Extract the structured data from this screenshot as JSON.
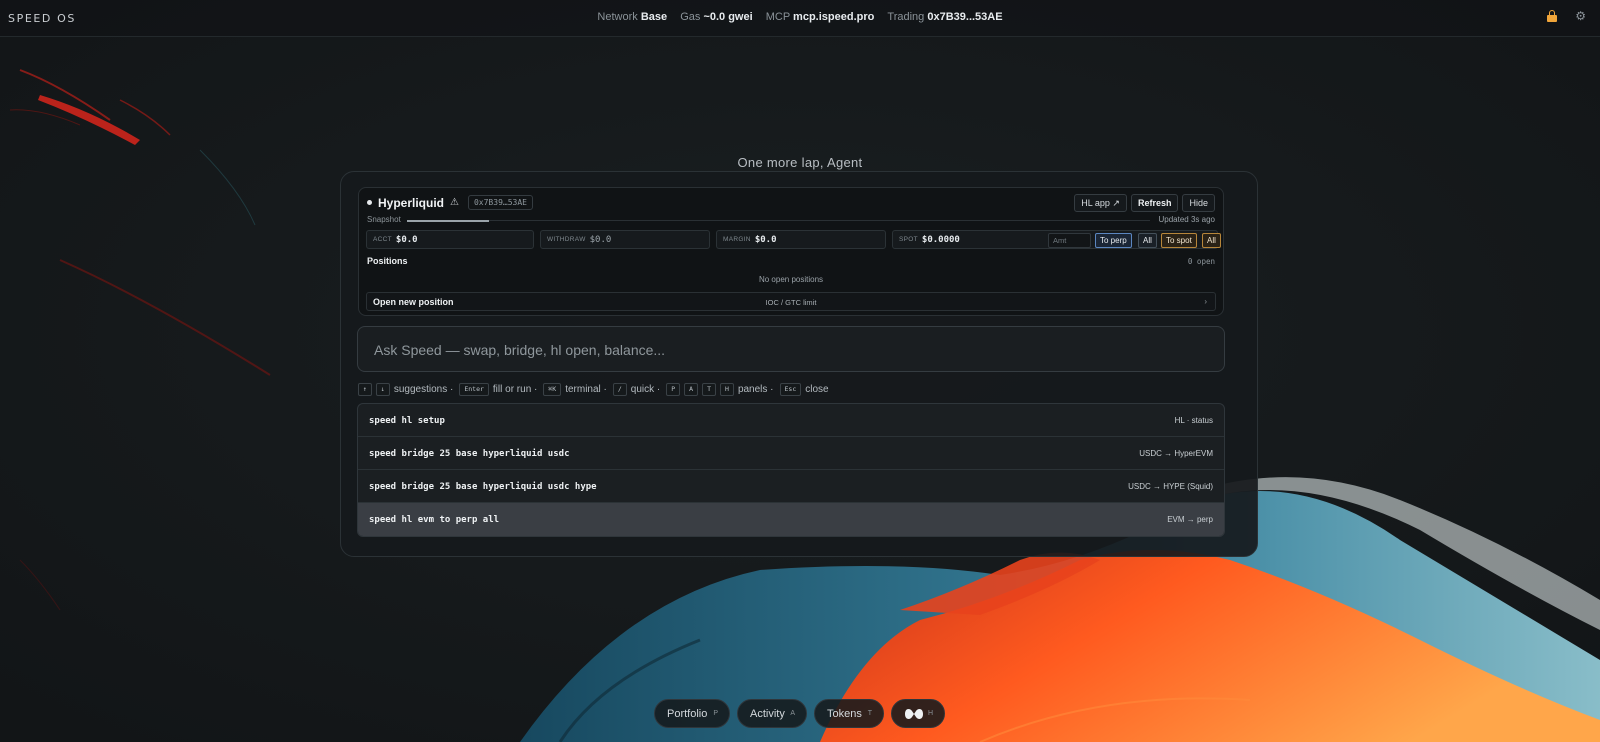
{
  "app": {
    "brand": "SPEED OS"
  },
  "status": {
    "network_label": "Network",
    "network_value": "Base",
    "gas_label": "Gas",
    "gas_value": "~0.0 gwei",
    "mcp_label": "MCP",
    "mcp_value": "mcp.ispeed.pro",
    "trading_label": "Trading",
    "trading_value": "0x7B39...53AE"
  },
  "icons": {
    "lock": "lock-icon",
    "settings": "gear-icon",
    "warning": "warning-icon"
  },
  "greeting": "One more lap, Agent",
  "hl": {
    "title": "Hyperliquid",
    "address": "0x7B39…53AE",
    "actions": {
      "app": "HL app ↗",
      "refresh": "Refresh",
      "hide": "Hide"
    },
    "snapshot_label": "Snapshot",
    "snapshot_progress": 0.11,
    "updated": "Updated 3s ago",
    "fields": {
      "acct_label": "ACCT",
      "acct_value": "$0.0",
      "withdraw_label": "WITHDRAW",
      "withdraw_value": "$0.0",
      "margin_label": "MARGIN",
      "margin_value": "$0.0",
      "spot_label": "SPOT",
      "spot_value": "$0.0000"
    },
    "amount_placeholder": "Amt",
    "transfer_buttons": {
      "to_perp": "To perp",
      "all_perp": "All",
      "to_spot": "To spot",
      "all_spot": "All"
    },
    "positions_title": "Positions",
    "positions_count": "0 open",
    "empty_note": "No open positions",
    "open_label": "Open new position",
    "open_mid": "IOC / GTC limit",
    "open_chevron": "›"
  },
  "ask": {
    "placeholder": "Ask Speed — swap, bridge, hl open, balance..."
  },
  "hints": {
    "up_key": "↑",
    "down_key": "↓",
    "suggestions": "suggestions ·",
    "enter_key": "Enter",
    "fill": "fill or run ·",
    "cmd_key": "⌘K",
    "terminal": "terminal ·",
    "slash_key": "/",
    "quick": "quick ·",
    "p_key": "P",
    "a_key": "A",
    "t_key": "T",
    "h_key": "H",
    "panels": "panels ·",
    "esc_key": "Esc",
    "close": "close"
  },
  "suggestions": [
    {
      "cmd": "speed hl setup",
      "meta": "HL · status"
    },
    {
      "cmd": "speed bridge 25 base hyperliquid usdc",
      "meta": "USDC → HyperEVM"
    },
    {
      "cmd": "speed bridge 25 base hyperliquid usdc hype",
      "meta": "USDC → HYPE (Squid)"
    },
    {
      "cmd": "speed hl evm to perp all",
      "meta": "EVM → perp"
    }
  ],
  "dock": {
    "portfolio": "Portfolio",
    "portfolio_key": "P",
    "activity": "Activity",
    "activity_key": "A",
    "tokens": "Tokens",
    "tokens_key": "T",
    "hl_key": "H"
  },
  "colors": {
    "accent_amber": "#f0a53a",
    "accent_blue": "#5b86c0",
    "bg": "#15191b"
  }
}
